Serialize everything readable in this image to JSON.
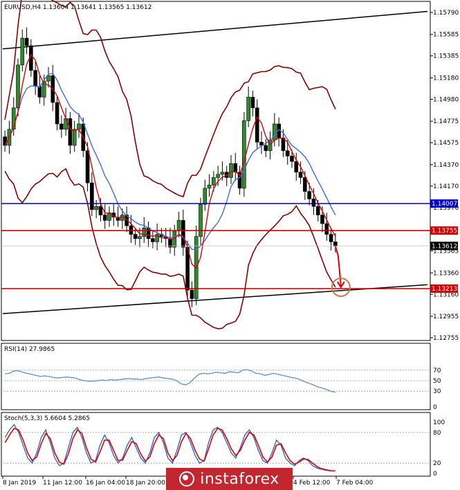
{
  "chart_data": {
    "type": "candlestick",
    "symbol_header": "EURUSD,H4  1.13604 1.13641 1.13565 1.13612",
    "price_axis": {
      "ticks": [
        "1.15790",
        "1.15585",
        "1.15385",
        "1.15180",
        "1.14980",
        "1.14775",
        "1.14575",
        "1.14370",
        "1.14170",
        "1.13970",
        "1.13765",
        "1.13565",
        "1.13360",
        "1.13160",
        "1.12955",
        "1.12755"
      ],
      "range": [
        1.12755,
        1.1579
      ]
    },
    "time_axis": {
      "labels": [
        "8 Jan 2019",
        "11 Jan 12:00",
        "16 Jan 04:00",
        "18 Jan 20:00",
        "4 Feb 12:00",
        "7 Feb 04:00"
      ]
    },
    "levels": [
      {
        "price": 1.14007,
        "label": "1.14007",
        "color": "#0000c8"
      },
      {
        "price": 1.13755,
        "label": "1.13755",
        "color": "#d40000"
      },
      {
        "price": 1.13213,
        "label": "1.13213",
        "color": "#d40000"
      }
    ],
    "current_price": {
      "price": 1.13612,
      "label": "1.13612"
    },
    "trendlines": [
      {
        "from": [
          0,
          1.1545
        ],
        "to": [
          1,
          1.158
        ]
      },
      {
        "from": [
          0,
          1.1298
        ],
        "to": [
          1,
          1.1325
        ]
      }
    ],
    "series": {
      "close": [
        1.1455,
        1.147,
        1.149,
        1.153,
        1.1555,
        1.1548,
        1.1525,
        1.151,
        1.15,
        1.1515,
        1.152,
        1.1495,
        1.1475,
        1.147,
        1.148,
        1.1455,
        1.147,
        1.1475,
        1.145,
        1.142,
        1.1395,
        1.1398,
        1.139,
        1.1385,
        1.1392,
        1.1388,
        1.1385,
        1.139,
        1.138,
        1.1372,
        1.1368,
        1.137,
        1.1378,
        1.1368,
        1.1365,
        1.1372,
        1.137,
        1.1368,
        1.136,
        1.1375,
        1.1385,
        1.136,
        1.132,
        1.1312,
        1.137,
        1.14,
        1.1415,
        1.1418,
        1.1425,
        1.1428,
        1.143,
        1.1425,
        1.1438,
        1.143,
        1.1415,
        1.1478,
        1.15,
        1.149,
        1.1458,
        1.1455,
        1.145,
        1.146,
        1.1475,
        1.1462,
        1.145,
        1.1445,
        1.144,
        1.143,
        1.1425,
        1.1412,
        1.1405,
        1.1398,
        1.139,
        1.1382,
        1.1372,
        1.1365,
        1.1361
      ]
    },
    "indicators": [
      {
        "name": "RSI(14) 27.9865",
        "levels": [
          70,
          50,
          30
        ],
        "axis": [
          "70",
          "50",
          "30",
          "0"
        ],
        "values": [
          63,
          64,
          68,
          69,
          66,
          64,
          62,
          60,
          58,
          59,
          58,
          56,
          55,
          56,
          57,
          56,
          55,
          52,
          50,
          49,
          49,
          50,
          51,
          50,
          52,
          51,
          52,
          53,
          54,
          53,
          53,
          52,
          54,
          55,
          56,
          57,
          55,
          54,
          53,
          50,
          44,
          42,
          46,
          55,
          62,
          64,
          63,
          64,
          66,
          65,
          64,
          67,
          66,
          65,
          70,
          71,
          68,
          64,
          63,
          60,
          62,
          64,
          62,
          60,
          58,
          56,
          55,
          52,
          48,
          45,
          42,
          38,
          36,
          33,
          30,
          28
        ]
      },
      {
        "name": "Stoch(5,3,3) 5.6604 5.2865",
        "levels": [
          80,
          20
        ],
        "axis": [
          "100",
          "80",
          "20",
          "0"
        ],
        "main": [
          70,
          85,
          95,
          80,
          55,
          30,
          20,
          40,
          70,
          85,
          60,
          30,
          15,
          20,
          50,
          80,
          90,
          70,
          40,
          20,
          25,
          55,
          75,
          60,
          35,
          20,
          30,
          55,
          70,
          50,
          30,
          20,
          40,
          70,
          80,
          60,
          30,
          20,
          45,
          75,
          80,
          60,
          35,
          20,
          25,
          60,
          85,
          90,
          80,
          60,
          40,
          30,
          50,
          75,
          85,
          70,
          45,
          25,
          20,
          40,
          65,
          55,
          30,
          20,
          15,
          25,
          30,
          25,
          15,
          10,
          8,
          6,
          5,
          5
        ],
        "signal": [
          60,
          75,
          88,
          85,
          65,
          40,
          25,
          32,
          58,
          78,
          68,
          40,
          22,
          18,
          38,
          68,
          85,
          78,
          50,
          28,
          22,
          42,
          65,
          65,
          45,
          25,
          26,
          45,
          62,
          58,
          38,
          24,
          32,
          58,
          75,
          68,
          40,
          25,
          35,
          62,
          78,
          68,
          45,
          28,
          24,
          48,
          75,
          88,
          85,
          68,
          48,
          35,
          45,
          65,
          80,
          75,
          55,
          32,
          22,
          32,
          55,
          58,
          40,
          25,
          18,
          22,
          28,
          27,
          20,
          13,
          9,
          7,
          5,
          5
        ]
      }
    ]
  }
}
